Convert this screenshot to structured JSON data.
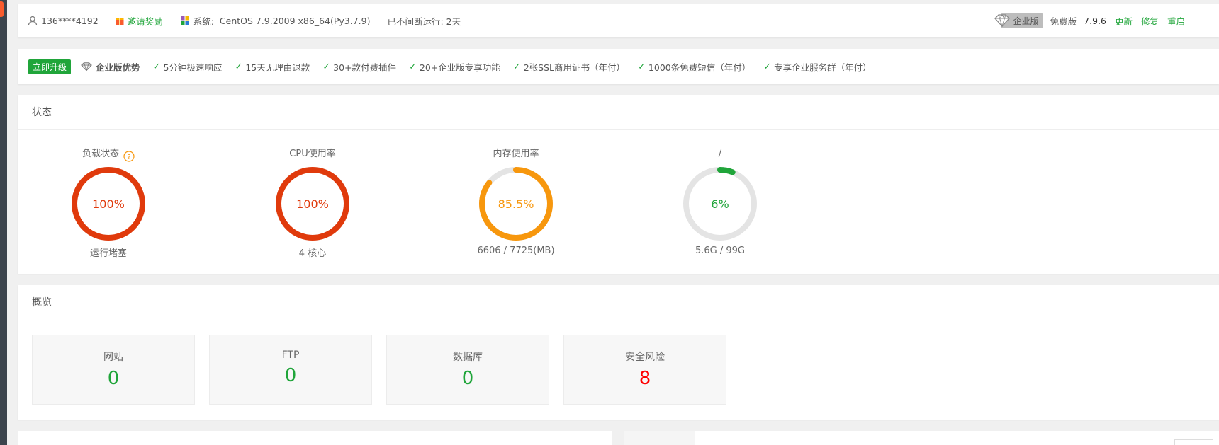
{
  "sidebar": {
    "accent": "#f95b2d",
    "bg": "#3c444d"
  },
  "topbar": {
    "user": "136****4192",
    "invite": "邀请奖励",
    "system_label": "系统:",
    "system_value": "CentOS 7.9.2009 x86_64(Py3.7.9)",
    "uptime": "已不间断运行: 2天",
    "edition_badge": "企业版",
    "edition": "免费版",
    "version": "7.9.6",
    "update": "更新",
    "repair": "修复",
    "restart": "重启"
  },
  "upgrade": {
    "button": "立即升级",
    "title": "企业版优势",
    "features": [
      "5分钟极速响应",
      "15天无理由退款",
      "30+款付费插件",
      "20+企业版专享功能",
      "2张SSL商用证书（年付）",
      "1000条免费短信（年付）",
      "专享企业服务群（年付）"
    ]
  },
  "status": {
    "title": "状态",
    "gauges": [
      {
        "title": "负载状态",
        "value": "100%",
        "percent": 100,
        "sub": "运行堵塞",
        "color": "#e03a0c",
        "help": true
      },
      {
        "title": "CPU使用率",
        "value": "100%",
        "percent": 100,
        "sub": "4 核心",
        "color": "#e03a0c"
      },
      {
        "title": "内存使用率",
        "value": "85.5%",
        "percent": 85.5,
        "sub": "6606 / 7725(MB)",
        "color": "#f7970d"
      },
      {
        "title": "/",
        "value": "6%",
        "percent": 6,
        "sub": "5.6G / 99G",
        "color": "#20a53a"
      }
    ]
  },
  "overview": {
    "title": "概览",
    "cards": [
      {
        "label": "网站",
        "value": "0",
        "alert": false
      },
      {
        "label": "FTP",
        "value": "0",
        "alert": false
      },
      {
        "label": "数据库",
        "value": "0",
        "alert": false
      },
      {
        "label": "安全风险",
        "value": "8",
        "alert": true
      }
    ]
  },
  "colors": {
    "green": "#20a53a",
    "red": "#ff0000",
    "track": "#e4e4e4"
  }
}
